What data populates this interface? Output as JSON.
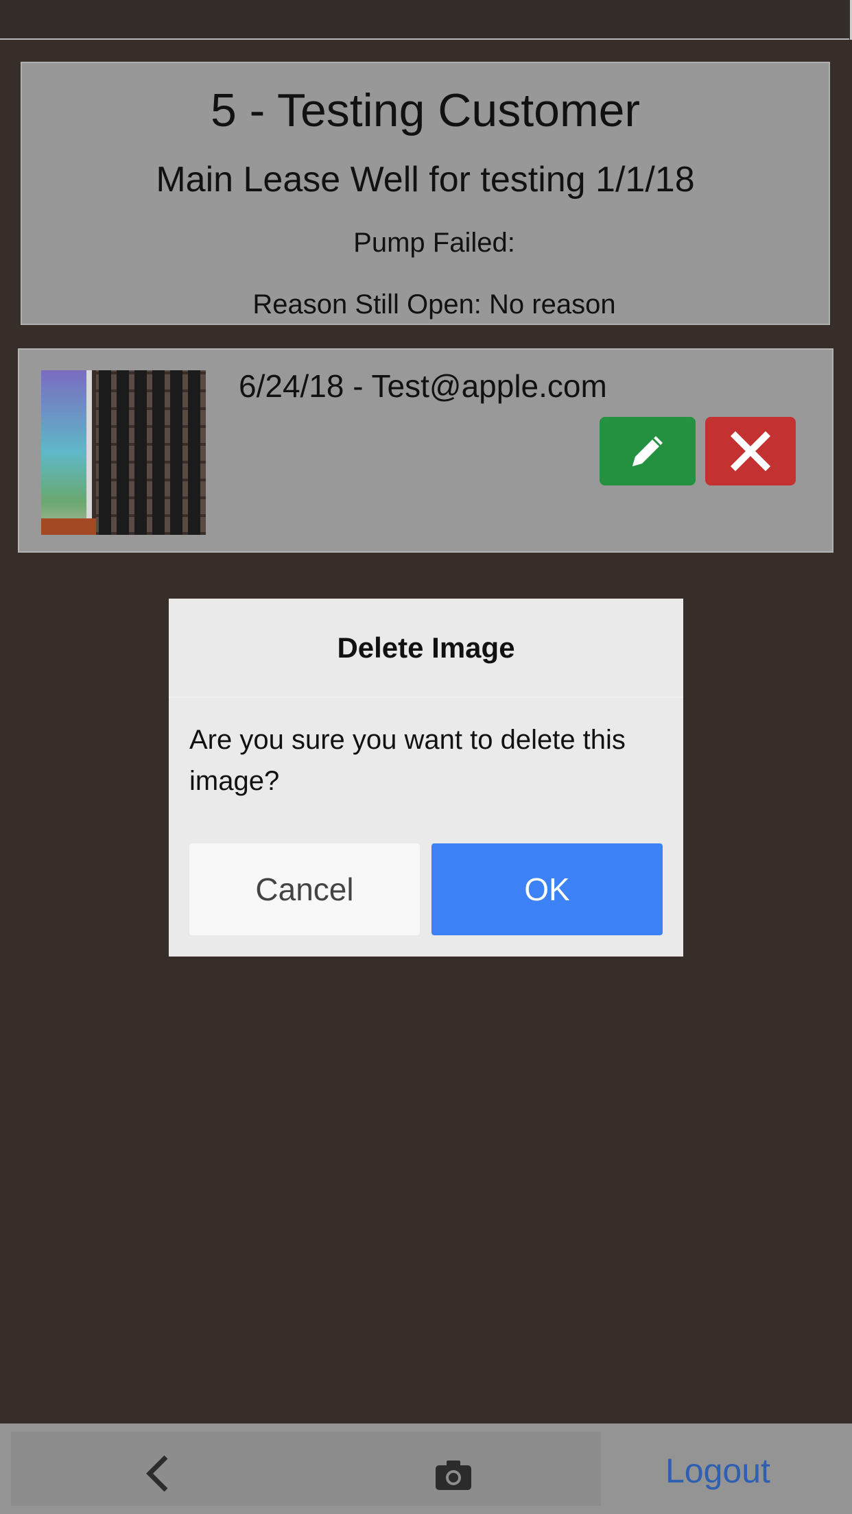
{
  "header": {
    "customer_title": "5 - Testing Customer",
    "well_title": "Main Lease Well for testing 1/1/18",
    "pump_failed": "Pump Failed:",
    "reason_open": "Reason Still Open: No reason"
  },
  "image_entry": {
    "meta": "6/24/18 - Test@apple.com",
    "edit_icon": "pencil-icon",
    "delete_icon": "close-icon",
    "colors": {
      "edit": "#23913f",
      "delete": "#c33230"
    }
  },
  "dialog": {
    "title": "Delete Image",
    "message": "Are you sure you want to delete this image?",
    "cancel_label": "Cancel",
    "ok_label": "OK",
    "colors": {
      "ok": "#3c82f6"
    }
  },
  "bottom_bar": {
    "back_icon": "chevron-left-icon",
    "camera_icon": "camera-icon",
    "logout_label": "Logout"
  }
}
